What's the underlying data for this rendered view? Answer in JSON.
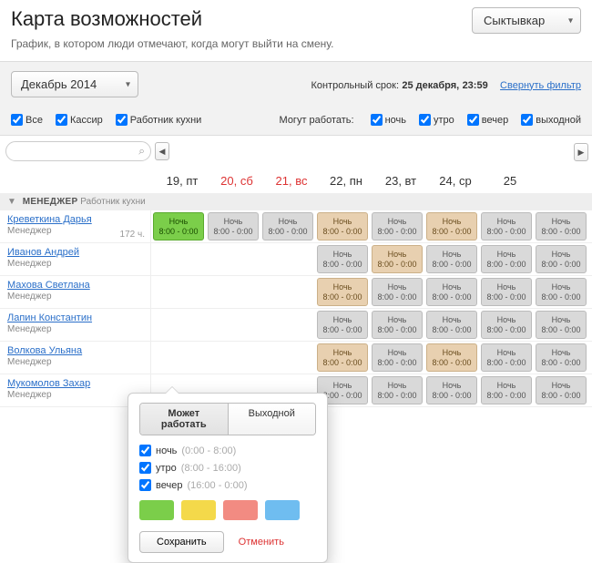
{
  "header": {
    "title": "Карта возможностей",
    "subtitle": "График, в котором люди отмечают, когда могут выйти на смену.",
    "city": "Сыктывкар"
  },
  "filter": {
    "month": "Декабрь 2014",
    "deadline_label": "Контрольный срок:",
    "deadline_date": "25 декабря,",
    "deadline_time": "23:59",
    "collapse": "Свернуть фильтр",
    "roles": {
      "all": "Все",
      "cashier": "Кассир",
      "kitchen": "Работник кухни"
    },
    "can_work_label": "Могут работать:",
    "shifts": {
      "night": "ночь",
      "morning": "утро",
      "evening": "вечер",
      "dayoff": "выходной"
    }
  },
  "dates": [
    {
      "label": "19, пт",
      "weekend": false
    },
    {
      "label": "20, сб",
      "weekend": true
    },
    {
      "label": "21, вс",
      "weekend": true
    },
    {
      "label": "22, пн",
      "weekend": false
    },
    {
      "label": "23, вт",
      "weekend": false
    },
    {
      "label": "24, ср",
      "weekend": false
    },
    {
      "label": "25",
      "weekend": false
    }
  ],
  "group": {
    "name": "МЕНЕДЖЕР",
    "sub": "Работник кухни"
  },
  "shift_text": {
    "title": "Ночь",
    "time": "8:00 - 0:00"
  },
  "employees": [
    {
      "name": "Креветкина Дарья",
      "role": "Менеджер",
      "hours": "172 ч.",
      "colors": [
        "green",
        "gray",
        "gray",
        "tan",
        "gray",
        "tan",
        "gray",
        "gray"
      ]
    },
    {
      "name": "Иванов Андрей",
      "role": "Менеджер",
      "colors": [
        "",
        "",
        "",
        "gray",
        "tan",
        "gray",
        "gray",
        "gray"
      ]
    },
    {
      "name": "Махова Светлана",
      "role": "Менеджер",
      "colors": [
        "",
        "",
        "",
        "tan",
        "gray",
        "gray",
        "gray",
        "gray"
      ]
    },
    {
      "name": "Лапин Константин",
      "role": "Менеджер",
      "colors": [
        "",
        "",
        "",
        "gray",
        "gray",
        "gray",
        "gray",
        "gray"
      ]
    },
    {
      "name": "Волкова Ульяна",
      "role": "Менеджер",
      "colors": [
        "",
        "",
        "",
        "tan",
        "gray",
        "tan",
        "gray",
        "gray"
      ]
    },
    {
      "name": "Мукомолов Захар",
      "role": "Менеджер",
      "colors": [
        "",
        "",
        "",
        "gray",
        "gray",
        "gray",
        "gray",
        "gray"
      ]
    }
  ],
  "popup": {
    "tab_can": "Может работать",
    "tab_off": "Выходной",
    "opts": [
      {
        "label": "ночь",
        "range": "(0:00 - 8:00)"
      },
      {
        "label": "утро",
        "range": "(8:00 - 16:00)"
      },
      {
        "label": "вечер",
        "range": "(16:00 - 0:00)"
      }
    ],
    "save": "Сохранить",
    "cancel": "Отменить"
  }
}
